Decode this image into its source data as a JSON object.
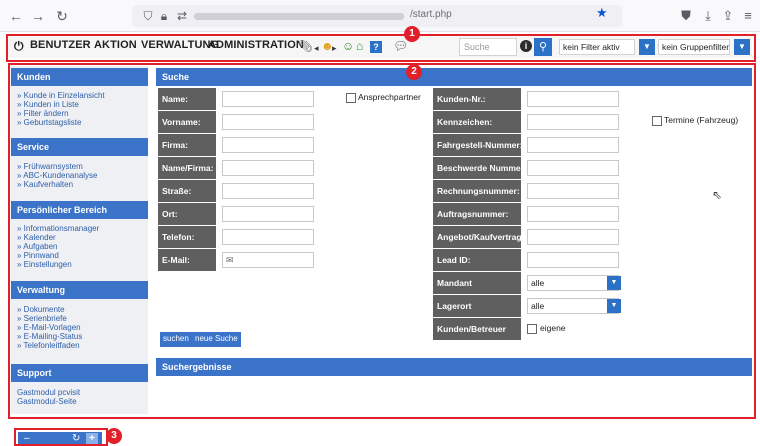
{
  "browser": {
    "url_text": "/start.php"
  },
  "toolbar": {
    "menu": [
      "BENUTZER",
      "AKTION",
      "VERWALTUNG",
      "ADMINISTRATION"
    ],
    "search_placeholder": "Suche",
    "filter_select": "kein Filter aktiv",
    "group_select": "kein Gruppenfilter"
  },
  "annotations": [
    "1",
    "2",
    "3"
  ],
  "sidebar": {
    "sections": [
      {
        "title": "Kunden",
        "links": [
          "» Kunde in Einzelansicht",
          "» Kunden in Liste",
          "» Filter ändern",
          "» Geburtstagsliste"
        ]
      },
      {
        "title": "Service",
        "links": [
          "» Frühwarnsystem",
          "» ABC-Kundenanalyse",
          "» Kaufverhalten"
        ]
      },
      {
        "title": "Persönlicher Bereich",
        "links": [
          "» Informationsmanager",
          "» Kalender",
          "» Aufgaben",
          "» Pinnwand",
          "» Einstellungen"
        ]
      },
      {
        "title": "Verwaltung",
        "links": [
          "» Dokumente",
          "» Serienbriefe",
          "» E-Mail-Vorlagen",
          "» E-Mailing-Status",
          "» Telefonleitfaden"
        ]
      },
      {
        "title": "Support",
        "links": [
          "Gastmodul pcvisit",
          "Gastmodul-Seite"
        ]
      }
    ]
  },
  "search": {
    "title": "Suche",
    "left_fields": [
      "Name:",
      "Vorname:",
      "Firma:",
      "Name/Firma:",
      "Straße:",
      "Ort:",
      "Telefon:",
      "E-Mail:"
    ],
    "contact_checkbox": "Ansprechpartner",
    "right_fields": [
      "Kunden-Nr.:",
      "Kennzeichen:",
      "Fahrgestell-Nummer:",
      "Beschwerde Nummer:",
      "Rechnungsnummer:",
      "Auftragsnummer:",
      "Angebot/Kaufvertrag:",
      "Lead ID:"
    ],
    "termine_checkbox": "Termine (Fahrzeug)",
    "mandant_label": "Mandant",
    "mandant_value": "alle",
    "lagerort_label": "Lagerort",
    "lagerort_value": "alle",
    "betreuer_label": "Kunden/Betreuer",
    "betreuer_checkbox": "eigene",
    "btn_search": "suchen",
    "btn_new": "neue Suche",
    "results_title": "Suchergebnisse"
  },
  "colors": {
    "accent_blue": "#3b73c9",
    "label_gray": "#5f5f5f",
    "annotation_red": "#e2202a"
  }
}
